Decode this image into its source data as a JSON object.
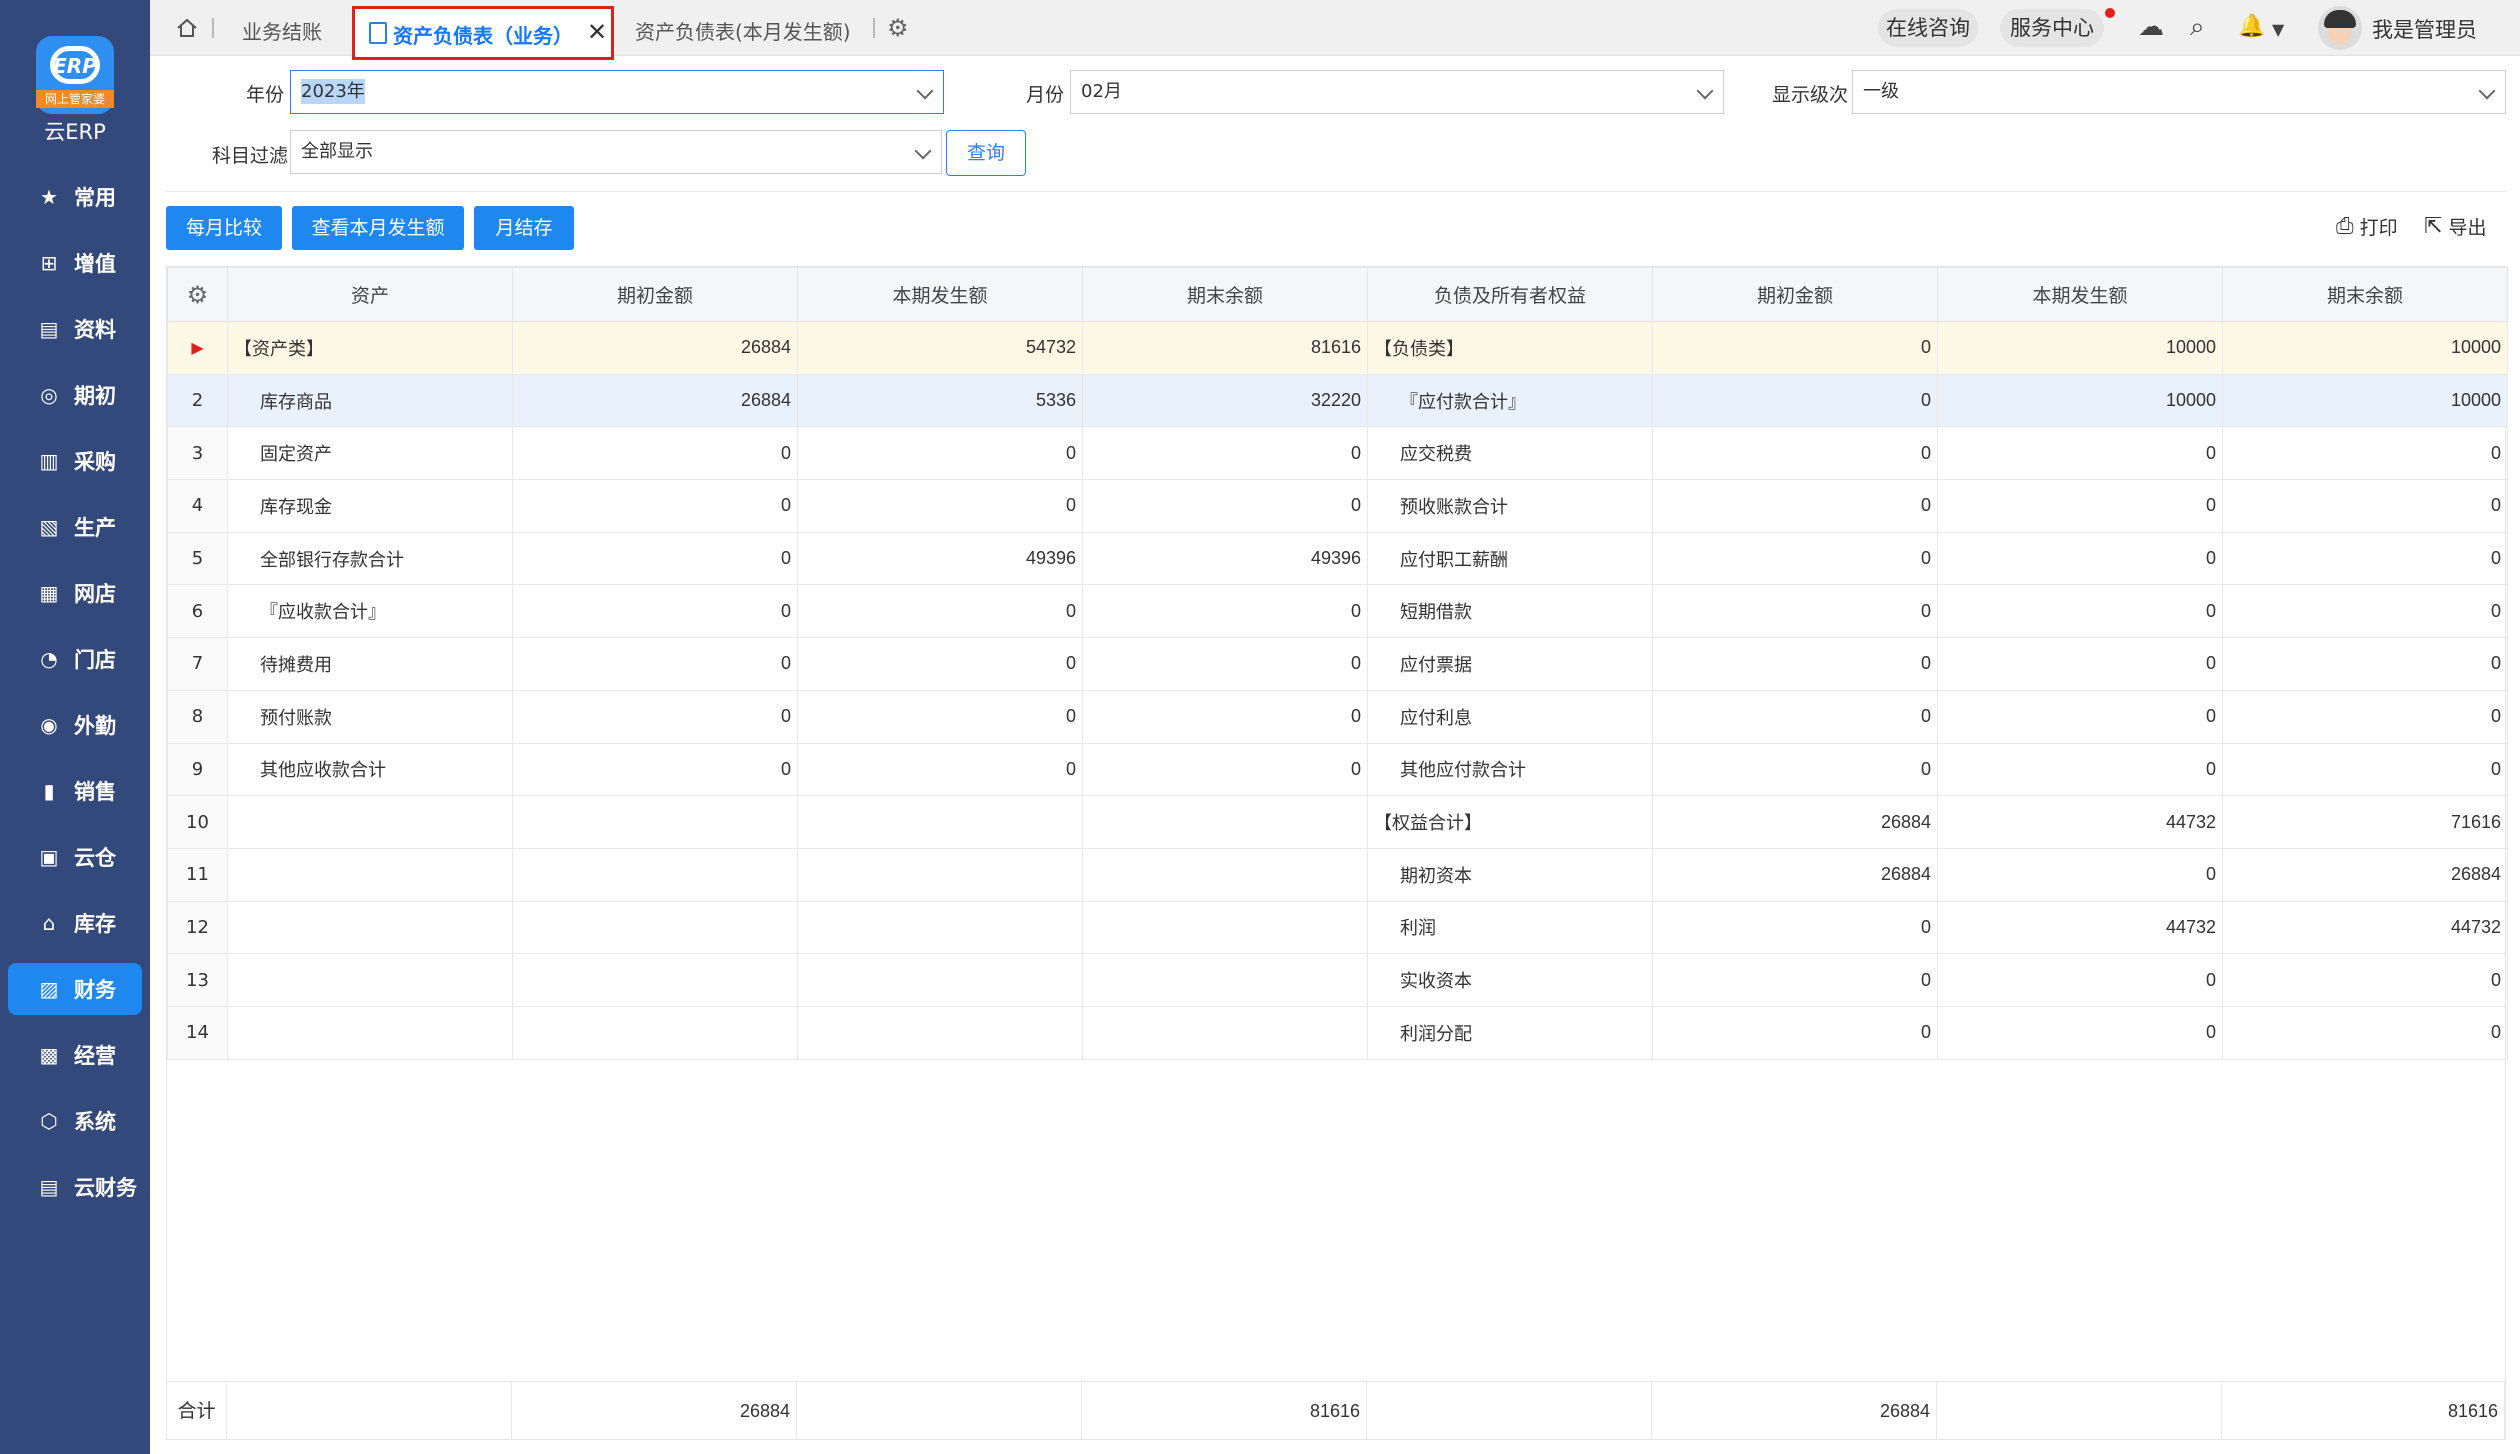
{
  "app": {
    "logo_brand": "ERP",
    "logo_ribbon": "网上管家婆",
    "logo_text": "云ERP"
  },
  "sidebar": {
    "items": [
      {
        "label": "常用",
        "icon": "star-icon",
        "glyph": "★"
      },
      {
        "label": "增值",
        "icon": "plus-square-icon",
        "glyph": "⊞"
      },
      {
        "label": "资料",
        "icon": "document-icon",
        "glyph": "▤"
      },
      {
        "label": "期初",
        "icon": "target-icon",
        "glyph": "◎"
      },
      {
        "label": "采购",
        "icon": "purchase-icon",
        "glyph": "▥"
      },
      {
        "label": "生产",
        "icon": "production-icon",
        "glyph": "▧"
      },
      {
        "label": "网店",
        "icon": "store-icon",
        "glyph": "▦"
      },
      {
        "label": "门店",
        "icon": "pie-icon",
        "glyph": "◔"
      },
      {
        "label": "外勤",
        "icon": "field-icon",
        "glyph": "◉"
      },
      {
        "label": "销售",
        "icon": "bar-chart-icon",
        "glyph": "▮"
      },
      {
        "label": "云仓",
        "icon": "warehouse-icon",
        "glyph": "▣"
      },
      {
        "label": "库存",
        "icon": "house-icon",
        "glyph": "⌂"
      },
      {
        "label": "财务",
        "icon": "finance-icon",
        "glyph": "▨",
        "active": true
      },
      {
        "label": "经营",
        "icon": "shop-icon",
        "glyph": "▩"
      },
      {
        "label": "系统",
        "icon": "hexagon-gear-icon",
        "glyph": "⬡"
      },
      {
        "label": "云财务",
        "icon": "cloud-finance-icon",
        "glyph": "▤"
      }
    ]
  },
  "topbar": {
    "tabs": [
      {
        "label": "业务结账"
      },
      {
        "label": "资产负债表（业务）",
        "active": true
      },
      {
        "label": "资产负债表(本月发生额)"
      }
    ],
    "close_glyph": "✕",
    "gear_glyph": "⚙",
    "online_consult": "在线咨询",
    "service_center": "服务中心",
    "cloud_glyph": "☁",
    "search_glyph": "⌕",
    "bell_glyph": "🔔",
    "admin_name": "我是管理员"
  },
  "filters": {
    "year_label": "年份",
    "year_value": "2023年",
    "month_label": "月份",
    "month_value": "02月",
    "level_label": "显示级次",
    "level_value": "一级",
    "subject_label": "科目过滤",
    "subject_value": "全部显示",
    "query_button": "查询"
  },
  "actions": {
    "monthly_compare": "每月比较",
    "view_month_amount": "查看本月发生额",
    "month_close": "月结存",
    "print": "打印",
    "export": "导出"
  },
  "table": {
    "headers": [
      "资产",
      "期初金额",
      "本期发生额",
      "期末余额",
      "负债及所有者权益",
      "期初金额",
      "本期发生额",
      "期末余额"
    ],
    "rows": [
      {
        "idx": "▶",
        "a_name": "【资产类】",
        "a_begin": "26884",
        "a_curr": "54732",
        "a_end": "81616",
        "l_name": "【负债类】",
        "l_begin": "0",
        "l_curr": "10000",
        "l_end": "10000"
      },
      {
        "idx": "2",
        "a_name": "库存商品",
        "a_begin": "26884",
        "a_curr": "5336",
        "a_end": "32220",
        "l_name": "『应付款合计』",
        "l_begin": "0",
        "l_curr": "10000",
        "l_end": "10000"
      },
      {
        "idx": "3",
        "a_name": "固定资产",
        "a_begin": "0",
        "a_curr": "0",
        "a_end": "0",
        "l_name": "应交税费",
        "l_begin": "0",
        "l_curr": "0",
        "l_end": "0"
      },
      {
        "idx": "4",
        "a_name": "库存现金",
        "a_begin": "0",
        "a_curr": "0",
        "a_end": "0",
        "l_name": "预收账款合计",
        "l_begin": "0",
        "l_curr": "0",
        "l_end": "0"
      },
      {
        "idx": "5",
        "a_name": "全部银行存款合计",
        "a_begin": "0",
        "a_curr": "49396",
        "a_end": "49396",
        "l_name": "应付职工薪酬",
        "l_begin": "0",
        "l_curr": "0",
        "l_end": "0"
      },
      {
        "idx": "6",
        "a_name": "『应收款合计』",
        "a_begin": "0",
        "a_curr": "0",
        "a_end": "0",
        "l_name": "短期借款",
        "l_begin": "0",
        "l_curr": "0",
        "l_end": "0"
      },
      {
        "idx": "7",
        "a_name": "待摊费用",
        "a_begin": "0",
        "a_curr": "0",
        "a_end": "0",
        "l_name": "应付票据",
        "l_begin": "0",
        "l_curr": "0",
        "l_end": "0"
      },
      {
        "idx": "8",
        "a_name": "预付账款",
        "a_begin": "0",
        "a_curr": "0",
        "a_end": "0",
        "l_name": "应付利息",
        "l_begin": "0",
        "l_curr": "0",
        "l_end": "0"
      },
      {
        "idx": "9",
        "a_name": "其他应收款合计",
        "a_begin": "0",
        "a_curr": "0",
        "a_end": "0",
        "l_name": "其他应付款合计",
        "l_begin": "0",
        "l_curr": "0",
        "l_end": "0"
      },
      {
        "idx": "10",
        "a_name": "",
        "a_begin": "",
        "a_curr": "",
        "a_end": "",
        "l_name": "【权益合计】",
        "l_begin": "26884",
        "l_curr": "44732",
        "l_end": "71616"
      },
      {
        "idx": "11",
        "a_name": "",
        "a_begin": "",
        "a_curr": "",
        "a_end": "",
        "l_name": "期初资本",
        "l_begin": "26884",
        "l_curr": "0",
        "l_end": "26884"
      },
      {
        "idx": "12",
        "a_name": "",
        "a_begin": "",
        "a_curr": "",
        "a_end": "",
        "l_name": "利润",
        "l_begin": "0",
        "l_curr": "44732",
        "l_end": "44732"
      },
      {
        "idx": "13",
        "a_name": "",
        "a_begin": "",
        "a_curr": "",
        "a_end": "",
        "l_name": "实收资本",
        "l_begin": "0",
        "l_curr": "0",
        "l_end": "0"
      },
      {
        "idx": "14",
        "a_name": "",
        "a_begin": "",
        "a_curr": "",
        "a_end": "",
        "l_name": "利润分配",
        "l_begin": "0",
        "l_curr": "0",
        "l_end": "0"
      }
    ],
    "footer": {
      "label": "合计",
      "a_begin": "26884",
      "a_end": "81616",
      "l_begin": "26884",
      "l_end": "81616"
    }
  }
}
